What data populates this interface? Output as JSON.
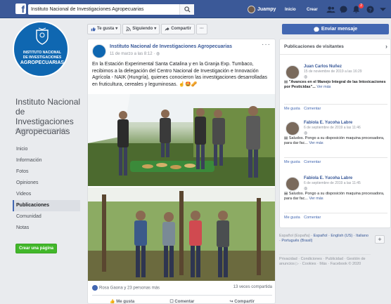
{
  "topbar": {
    "logo": "f",
    "search_value": "Instituto Nacional de Investigaciones Agropecuarias",
    "user_name": "Juampy",
    "home_label": "Inicio",
    "create_label": "Crear",
    "notifications_count": "2"
  },
  "page": {
    "name": "Instituto Nacional de Investigaciones Agropecuarias",
    "handle": "@agroinvestigacionecuador",
    "logo_lines": [
      "INSTITUTO NACIONAL",
      "DE INVESTIGACIONES",
      "AGROPECUARIAS"
    ],
    "nav": [
      "Inicio",
      "Información",
      "Fotos",
      "Opiniones",
      "Videos",
      "Publicaciones",
      "Comunidad",
      "Notas"
    ],
    "active_nav": "Publicaciones",
    "create_page_label": "Crear una página"
  },
  "action_bar": {
    "like_label": "Te gusta",
    "follow_label": "Siguiendo",
    "share_label": "Compartir",
    "more_label": "···",
    "send_message_label": "Enviar mensaje"
  },
  "post": {
    "author": "Instituto Nacional de Investigaciones Agropecuarias",
    "time": "11 de marzo a las 8:12 · ",
    "text": "En la Estación Experimental Santa Catalina y en la Granja Exp. Tumbaco, recibimos a la delegación del Centro Nacional de Investigación e Innovación Agrícola - NAIK (Hungría), quienes conocieron las investigaciones desarrolladas en fruticultura, cereales y leguminosas. ☝🤩🥜",
    "reactions": "Rosa Gaona y 23 personas más",
    "shares": "13 veces compartida",
    "like_action": "Me gusta",
    "comment_action": "Comentar",
    "share_action": "Compartir"
  },
  "visitors": {
    "title": "Publicaciones de visitantes",
    "posts": [
      {
        "name": "Juan Carlos Nuñez",
        "date": "15 de noviembre de 2019 a las 16:29",
        "text": "\"Avances en el Manejo Integral de las Intoxicaciones por Pesticidas\"...",
        "more": "Ver más",
        "like": "Me gusta",
        "comment": "Comentar"
      },
      {
        "name": "Fabiola E. Yucoha Labre",
        "date": "6 de septiembre de 2019 a las 11:46",
        "text": "Saludos. Pongo a su disposición maquina procesadora, para dar fac...",
        "more": "Ver más",
        "like": "Me gusta",
        "comment": "Comentar"
      },
      {
        "name": "Fabiola E. Yucoha Labre",
        "date": "6 de septiembre de 2019 a las 11:45",
        "text": "Saludos. Pongo a su disposición maquina procesadora, para dar fac...",
        "more": "Ver más",
        "like": "Me gusta",
        "comment": "Comentar"
      }
    ]
  },
  "languages": {
    "current": "Español (España)",
    "others": "· Español · English (US) · Italiano · Português (Brasil)",
    "footer": "Privacidad · Condiciones · Publicidad · Gestión de anuncios ▷ · Cookies · Más · Facebook © 2020"
  },
  "colors": {
    "brand": "#3b5998",
    "button_primary": "#4267b2",
    "create_page": "#42b72a",
    "logo_bg": "#0f67b1"
  }
}
